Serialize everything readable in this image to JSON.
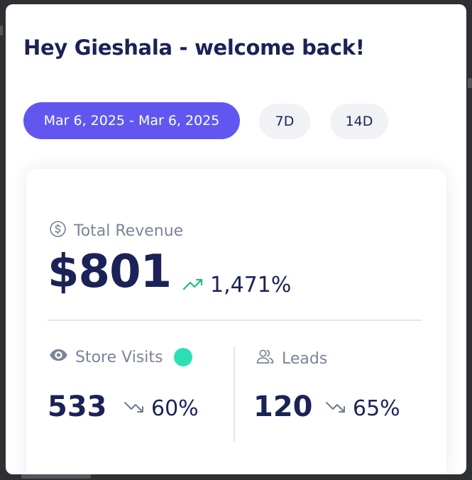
{
  "greeting": "Hey Gieshala - welcome back!",
  "date_range": {
    "selected": "Mar 6, 2025 - Mar 6, 2025",
    "options": [
      "7D",
      "14D"
    ]
  },
  "metrics": {
    "revenue": {
      "label": "Total Revenue",
      "value": "$801",
      "change": "1,471%",
      "direction": "up",
      "icon": "dollar-circle-icon"
    },
    "store_visits": {
      "label": "Store Visits",
      "value": "533",
      "change": "60%",
      "direction": "down",
      "icon": "eye-icon",
      "live_indicator_color": "#2de0b4"
    },
    "leads": {
      "label": "Leads",
      "value": "120",
      "change": "65%",
      "direction": "down",
      "icon": "users-icon"
    }
  },
  "colors": {
    "accent": "#6157f0",
    "heading": "#1b2257",
    "muted": "#7b8498",
    "trend_up": "#1fb98c",
    "trend_down": "#6d7a90"
  }
}
